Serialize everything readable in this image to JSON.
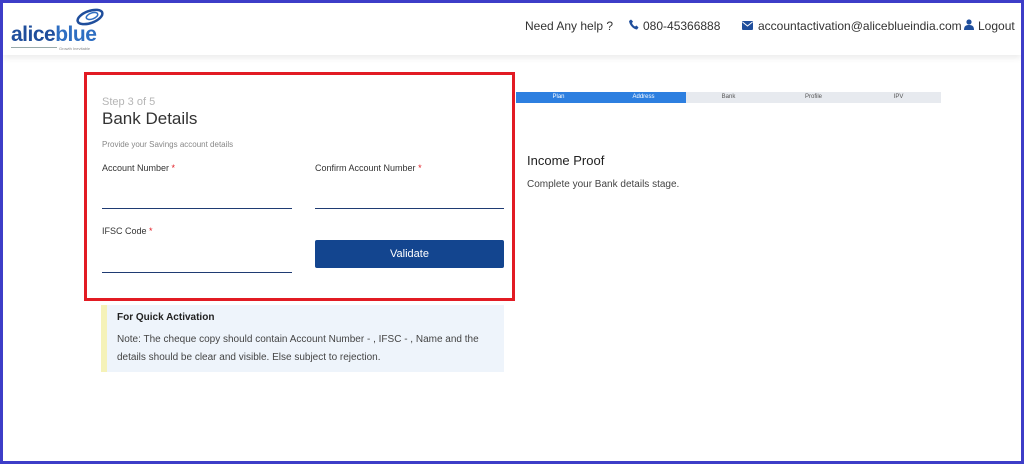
{
  "header": {
    "logo": {
      "text_dark": "alice",
      "text_light": "blue",
      "tagline": "Growth Inevitable"
    },
    "help_text": "Need Any help ?",
    "phone": "080-45366888",
    "email": "accountactivation@aliceblueindia.com",
    "logout_label": "Logout",
    "icons": {
      "phone": "phone-icon",
      "email": "envelope-icon",
      "logout": "user-icon"
    },
    "brand_color": "#1f4e9c"
  },
  "form": {
    "step": "Step 3 of 5",
    "title": "Bank Details",
    "subtitle": "Provide your Savings account details",
    "account_number": {
      "label": "Account Number",
      "required": "*",
      "value": ""
    },
    "confirm_account_number": {
      "label": "Confirm Account Number",
      "required": "*",
      "value": ""
    },
    "ifsc": {
      "label": "IFSC Code",
      "required": "*",
      "value": ""
    },
    "validate_label": "Validate",
    "button_color": "#13458f"
  },
  "note": {
    "title": "For Quick Activation",
    "text": "Note: The cheque copy should contain Account Number - , IFSC - , Name and the details should be clear and visible. Else subject to rejection."
  },
  "progress": {
    "steps": [
      "Plan",
      "Address",
      "Bank",
      "Profile",
      "IPV"
    ],
    "completed_steps": 2,
    "fill_color": "#2d7fe0"
  },
  "income_proof": {
    "title": "Income Proof",
    "text": "Complete your Bank details stage."
  }
}
